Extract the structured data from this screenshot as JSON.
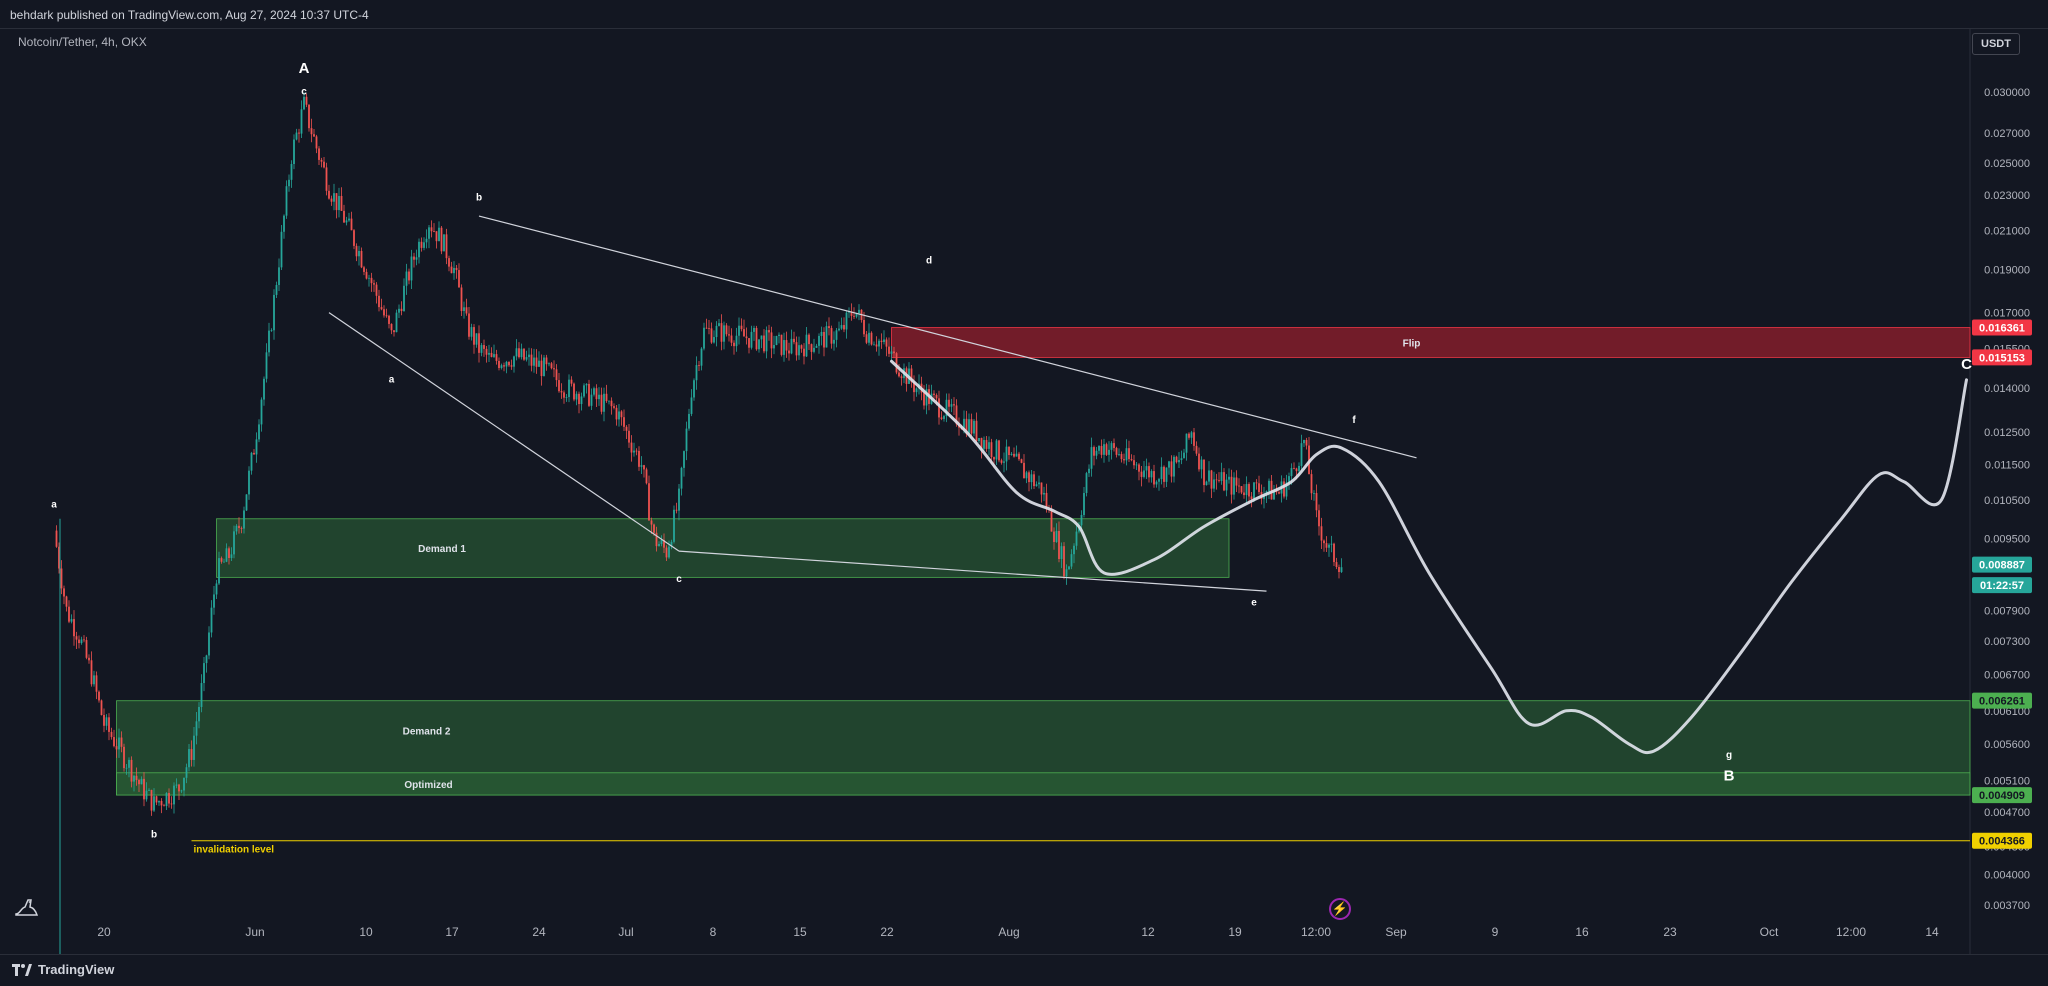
{
  "header": {
    "publisher_line": "behdark published on TradingView.com, Aug 27, 2024 10:37 UTC-4"
  },
  "symbol": {
    "description": "Notcoin/Tether, 4h, OKX",
    "currency": "USDT"
  },
  "footer": {
    "brand": "TradingView"
  },
  "icons": {
    "brand_logo": "tradingview-logo-icon",
    "drawing_mascot": "dino-icon",
    "replay": "lightning-bolt-icon"
  },
  "colors": {
    "background": "#131722",
    "up_candle": "#26a69a",
    "down_candle": "#ef5350",
    "demand_zone": "#2a5c35",
    "flip_zone": "#8b1e2c",
    "price_red": "#f23645",
    "price_green": "#4caf50",
    "price_teal": "#26a69a",
    "invalidation": "#f0d000",
    "projection": "#e0e3eb"
  },
  "chart_data": {
    "type": "candlestick",
    "xaxis_ticks": [
      "20",
      "Jun",
      "10",
      "17",
      "24",
      "Jul",
      "8",
      "15",
      "22",
      "Aug",
      "12",
      "19",
      "12:00",
      "Sep",
      "9",
      "16",
      "23",
      "Oct",
      "12:00",
      "14"
    ],
    "yaxis_ticks": [
      "0.030000",
      "0.027000",
      "0.025000",
      "0.023000",
      "0.021000",
      "0.019000",
      "0.017000",
      "0.015500",
      "0.014000",
      "0.012500",
      "0.011500",
      "0.010500",
      "0.009500",
      "0.008500",
      "0.007900",
      "0.007300",
      "0.006700",
      "0.006100",
      "0.005600",
      "0.005100",
      "0.004700",
      "0.004300",
      "0.004000",
      "0.003700"
    ],
    "yaxis_scale": "log",
    "price_path_x": [
      "2024-05-16",
      "2024-05-17",
      "2024-05-18",
      "2024-05-19",
      "2024-05-20",
      "2024-05-21",
      "2024-05-22",
      "2024-05-23",
      "2024-05-24",
      "2024-05-25",
      "2024-05-26",
      "2024-05-27",
      "2024-05-28",
      "2024-05-29",
      "2024-05-30",
      "2024-05-31",
      "2024-06-01",
      "2024-06-02",
      "2024-06-03",
      "2024-06-04",
      "2024-06-05",
      "2024-06-06",
      "2024-06-07",
      "2024-06-08",
      "2024-06-09",
      "2024-06-10",
      "2024-06-11",
      "2024-06-12",
      "2024-06-13",
      "2024-06-14",
      "2024-06-15",
      "2024-06-16",
      "2024-06-17",
      "2024-06-18",
      "2024-06-19",
      "2024-06-20",
      "2024-06-22",
      "2024-06-24",
      "2024-06-26",
      "2024-06-28",
      "2024-06-30",
      "2024-07-02",
      "2024-07-03",
      "2024-07-04",
      "2024-07-05",
      "2024-07-06",
      "2024-07-07",
      "2024-07-08",
      "2024-07-10",
      "2024-07-12",
      "2024-07-14",
      "2024-07-16",
      "2024-07-18",
      "2024-07-19",
      "2024-07-20",
      "2024-07-21",
      "2024-07-22",
      "2024-07-24",
      "2024-07-26",
      "2024-07-28",
      "2024-07-30",
      "2024-08-01",
      "2024-08-03",
      "2024-08-05",
      "2024-08-06",
      "2024-08-07",
      "2024-08-08",
      "2024-08-10",
      "2024-08-12",
      "2024-08-14",
      "2024-08-15",
      "2024-08-16",
      "2024-08-18",
      "2024-08-20",
      "2024-08-22",
      "2024-08-23",
      "2024-08-24",
      "2024-08-25",
      "2024-08-26",
      "2024-08-27"
    ],
    "price_path_y": [
      0.0097,
      0.0079,
      0.0074,
      0.0067,
      0.0059,
      0.0056,
      0.0053,
      0.005,
      0.0048,
      0.0049,
      0.005,
      0.0055,
      0.0067,
      0.0087,
      0.0091,
      0.01,
      0.012,
      0.015,
      0.0195,
      0.0255,
      0.029,
      0.026,
      0.0235,
      0.022,
      0.0205,
      0.019,
      0.0175,
      0.016,
      0.018,
      0.02,
      0.0215,
      0.0205,
      0.019,
      0.0165,
      0.0155,
      0.015,
      0.0152,
      0.0148,
      0.014,
      0.0137,
      0.0132,
      0.0115,
      0.0095,
      0.0092,
      0.0105,
      0.014,
      0.0162,
      0.0162,
      0.016,
      0.0158,
      0.0155,
      0.0158,
      0.0162,
      0.0172,
      0.0162,
      0.0158,
      0.0152,
      0.014,
      0.0133,
      0.0128,
      0.012,
      0.0115,
      0.0108,
      0.0087,
      0.01,
      0.0118,
      0.0121,
      0.0116,
      0.0112,
      0.0115,
      0.0125,
      0.0112,
      0.0109,
      0.0108,
      0.0107,
      0.0112,
      0.0122,
      0.01,
      0.0092,
      0.00889
    ],
    "wave_labels": [
      {
        "text": "a",
        "date": "2024-05-16",
        "price": 0.0103
      },
      {
        "text": "b",
        "date": "2024-05-24",
        "price": 0.0044
      },
      {
        "text": "A",
        "date": "2024-06-05",
        "price": 0.0315
      },
      {
        "text": "c",
        "date": "2024-06-05",
        "price": 0.0298
      },
      {
        "text": "a",
        "date": "2024-06-12",
        "price": 0.0142
      },
      {
        "text": "b",
        "date": "2024-06-19",
        "price": 0.0227
      },
      {
        "text": "c",
        "date": "2024-07-05",
        "price": 0.0085
      },
      {
        "text": "d",
        "date": "2024-07-25",
        "price": 0.0193
      },
      {
        "text": "e",
        "date": "2024-08-20",
        "price": 0.008
      },
      {
        "text": "f",
        "date": "2024-08-28",
        "price": 0.0128
      },
      {
        "text": "g",
        "date": "2024-09-27",
        "price": 0.0054
      },
      {
        "text": "B",
        "date": "2024-09-27",
        "price": 0.0051
      },
      {
        "text": "C",
        "date": "2024-10-16",
        "price": 0.0147
      }
    ],
    "trendlines": [
      {
        "name": "upper-triangle-line",
        "from": {
          "date": "2024-06-19",
          "price": 0.0218
        },
        "to": {
          "date": "2024-09-02",
          "price": 0.0117
        }
      },
      {
        "name": "lower-left-line",
        "from": {
          "date": "2024-06-07",
          "price": 0.017
        },
        "to": {
          "date": "2024-07-05",
          "price": 0.0092
        }
      },
      {
        "name": "lower-triangle-line",
        "from": {
          "date": "2024-07-05",
          "price": 0.0092
        },
        "to": {
          "date": "2024-08-21",
          "price": 0.0083
        }
      }
    ],
    "zones": [
      {
        "label": "Demand 1",
        "date_from": "2024-05-29",
        "date_to": "2024-08-18",
        "price_top": 0.01,
        "price_bottom": 0.0086
      },
      {
        "label": "Demand 2",
        "date_from": "2024-05-21",
        "date_to": "",
        "price_top": 0.00626,
        "price_bottom": 0.00491
      },
      {
        "label": "Optimized",
        "date_from": "2024-05-21",
        "date_to": "",
        "price_top": 0.0052,
        "price_bottom": 0.00491
      },
      {
        "label": "Flip",
        "date_from": "2024-07-22",
        "date_to": "",
        "price_top": 0.01636,
        "price_bottom": 0.01515
      }
    ],
    "invalidation_level": {
      "label": "invalidation level",
      "price": 0.004366,
      "date_from": "2024-05-27"
    },
    "projection_path_x": [
      "2024-07-22",
      "2024-07-28",
      "2024-08-01",
      "2024-08-04",
      "2024-08-06",
      "2024-08-08",
      "2024-08-12",
      "2024-08-16",
      "2024-08-20",
      "2024-08-23",
      "2024-08-25",
      "2024-08-27",
      "2024-08-30",
      "2024-09-03",
      "2024-09-08",
      "2024-09-11",
      "2024-09-14",
      "2024-09-16",
      "2024-09-19",
      "2024-09-21",
      "2024-09-24",
      "2024-09-28",
      "2024-10-02",
      "2024-10-06",
      "2024-10-09",
      "2024-10-11",
      "2024-10-14",
      "2024-10-16"
    ],
    "projection_path_y": [
      0.015,
      0.0125,
      0.0107,
      0.0102,
      0.0098,
      0.0087,
      0.009,
      0.0098,
      0.0105,
      0.011,
      0.0118,
      0.012,
      0.011,
      0.0087,
      0.0068,
      0.0059,
      0.0061,
      0.006,
      0.0056,
      0.0055,
      0.006,
      0.0071,
      0.0085,
      0.01,
      0.0112,
      0.011,
      0.0105,
      0.0143
    ],
    "price_labels": [
      {
        "value": "0.016361",
        "color": "#f23645",
        "price": 0.016361
      },
      {
        "value": "0.015153",
        "color": "#f23645",
        "price": 0.015153
      },
      {
        "value": "0.008887",
        "color": "#26a69a",
        "price": 0.008887
      },
      {
        "value": "01:22:57",
        "color": "#26a69a",
        "price": 0.00843
      },
      {
        "value": "0.006261",
        "color": "#4caf50",
        "price": 0.006261
      },
      {
        "value": "0.004909",
        "color": "#4caf50",
        "price": 0.004909
      },
      {
        "value": "0.004366",
        "color": "#f0d000",
        "price": 0.004366
      }
    ]
  }
}
